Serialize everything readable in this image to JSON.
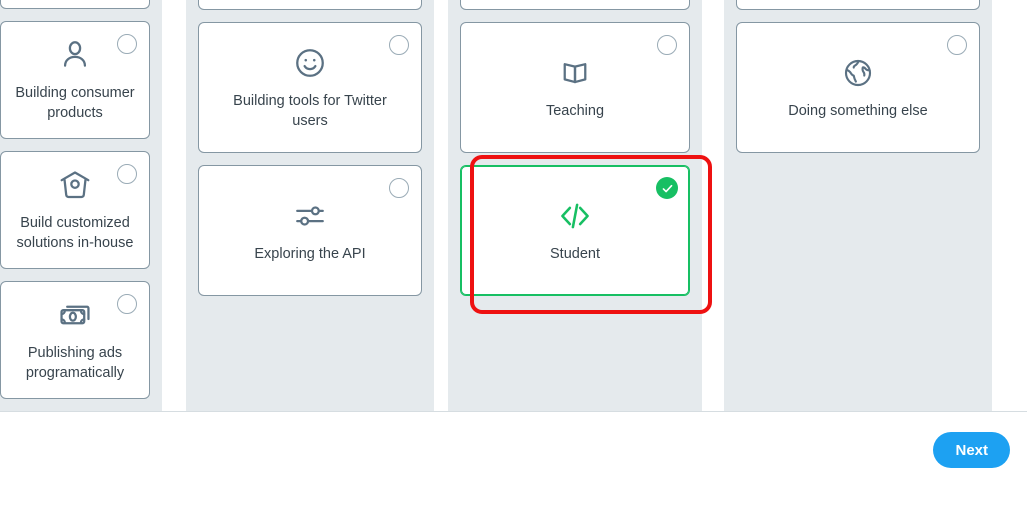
{
  "page": {
    "selection_style": "single-select card grid",
    "accent_blue": "#1da1f2",
    "selected_green": "#17bf63",
    "card_border": "#8597a3",
    "column_background": "#e5eaed",
    "highlight_ring_color": "#ee1111"
  },
  "columns": [
    {
      "id": "column-1",
      "cards": [
        {
          "label": "",
          "icon": "clipped-card",
          "clipped": true,
          "selected": false
        },
        {
          "label": "Building consumer products",
          "icon": "person-icon",
          "selected": false
        },
        {
          "label": "Build customized solutions in-house",
          "icon": "birdhouse-icon",
          "selected": false
        },
        {
          "label": "Publishing ads programatically",
          "icon": "money-icon",
          "selected": false
        }
      ]
    },
    {
      "id": "column-2",
      "cards": [
        {
          "label": "",
          "icon": "clipped-card",
          "clipped": true,
          "selected": false
        },
        {
          "label": "Building tools for Twitter users",
          "icon": "smiley-icon",
          "selected": false
        },
        {
          "label": "Exploring the API",
          "icon": "sliders-icon",
          "selected": false
        }
      ]
    },
    {
      "id": "column-3",
      "cards": [
        {
          "label": "",
          "icon": "clipped-card",
          "clipped": true,
          "selected": false
        },
        {
          "label": "Teaching",
          "icon": "book-icon",
          "selected": false
        },
        {
          "label": "Student",
          "icon": "code-icon",
          "selected": true
        }
      ]
    },
    {
      "id": "column-4",
      "cards": [
        {
          "label": "",
          "icon": "clipped-card",
          "clipped": true,
          "selected": false
        },
        {
          "label": "Doing something else",
          "icon": "globe-icon",
          "selected": false
        }
      ]
    }
  ],
  "footer": {
    "next_label": "Next"
  }
}
